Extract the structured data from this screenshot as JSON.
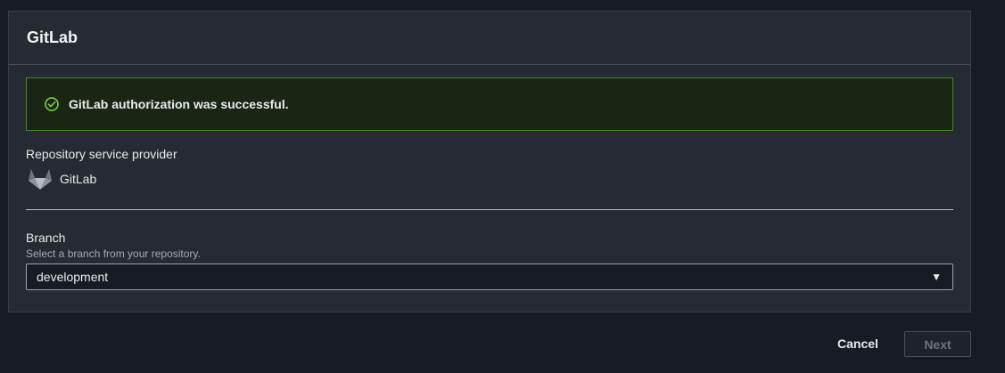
{
  "header": {
    "title": "GitLab"
  },
  "alert": {
    "icon": "check-circle-icon",
    "message": "GitLab authorization was successful.",
    "color": "#3c8a2b"
  },
  "provider": {
    "label": "Repository service provider",
    "icon": "gitlab-logo-icon",
    "name": "GitLab"
  },
  "branch": {
    "label": "Branch",
    "description": "Select a branch from your repository.",
    "selected": "development"
  },
  "footer": {
    "cancel_label": "Cancel",
    "next_label": "Next"
  }
}
